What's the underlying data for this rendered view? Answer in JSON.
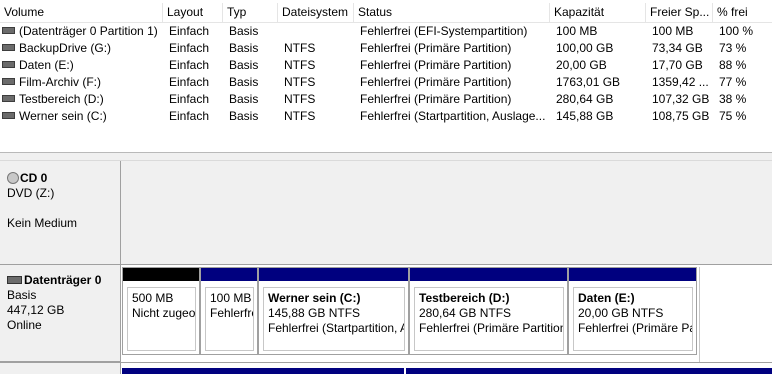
{
  "table": {
    "columns": [
      "Volume",
      "Layout",
      "Typ",
      "Dateisystem",
      "Status",
      "Kapazität",
      "Freier Sp...",
      "% frei"
    ],
    "rows": [
      {
        "volume": "(Datenträger 0 Partition 1)",
        "layout": "Einfach",
        "typ": "Basis",
        "fs": "",
        "status": "Fehlerfrei (EFI-Systempartition)",
        "cap": "100 MB",
        "free": "100 MB",
        "pct": "100 %"
      },
      {
        "volume": "BackupDrive (G:)",
        "layout": "Einfach",
        "typ": "Basis",
        "fs": "NTFS",
        "status": "Fehlerfrei (Primäre Partition)",
        "cap": "100,00 GB",
        "free": "73,34 GB",
        "pct": "73 %"
      },
      {
        "volume": "Daten (E:)",
        "layout": "Einfach",
        "typ": "Basis",
        "fs": "NTFS",
        "status": "Fehlerfrei (Primäre Partition)",
        "cap": "20,00 GB",
        "free": "17,70 GB",
        "pct": "88 %"
      },
      {
        "volume": "Film-Archiv (F:)",
        "layout": "Einfach",
        "typ": "Basis",
        "fs": "NTFS",
        "status": "Fehlerfrei (Primäre Partition)",
        "cap": "1763,01 GB",
        "free": "1359,42 ...",
        "pct": "77 %"
      },
      {
        "volume": "Testbereich (D:)",
        "layout": "Einfach",
        "typ": "Basis",
        "fs": "NTFS",
        "status": "Fehlerfrei (Primäre Partition)",
        "cap": "280,64 GB",
        "free": "107,32 GB",
        "pct": "38 %"
      },
      {
        "volume": "Werner sein (C:)",
        "layout": "Einfach",
        "typ": "Basis",
        "fs": "NTFS",
        "status": "Fehlerfrei (Startpartition, Auslage...",
        "cap": "145,88 GB",
        "free": "108,75 GB",
        "pct": "75 %"
      }
    ]
  },
  "cd": {
    "title": "CD 0",
    "type": "DVD (Z:)",
    "media": "Kein Medium",
    "icon": "cd-drive-icon"
  },
  "disk0": {
    "title": "Datenträger 0",
    "type": "Basis",
    "size": "447,12 GB",
    "state": "Online",
    "icon": "hard-disk-icon",
    "partitions": [
      {
        "name": "",
        "size": "500 MB",
        "status": "Nicht zugeordnet"
      },
      {
        "name": "",
        "size": "100 MB",
        "status": "Fehlerfrei (EFI-Systempartition)"
      },
      {
        "name": "Werner sein  (C:)",
        "size": "145,88 GB NTFS",
        "status": "Fehlerfrei (Startpartition, Auslagerungsdatei)"
      },
      {
        "name": "Testbereich  (D:)",
        "size": "280,64 GB NTFS",
        "status": "Fehlerfrei (Primäre Partition)"
      },
      {
        "name": "Daten  (E:)",
        "size": "20,00 GB NTFS",
        "status": "Fehlerfrei (Primäre Partition)"
      }
    ]
  },
  "colors": {
    "primary_partition_bar": "#00007f",
    "unallocated_bar": "#000000",
    "label_background": "#f0f0f0"
  }
}
